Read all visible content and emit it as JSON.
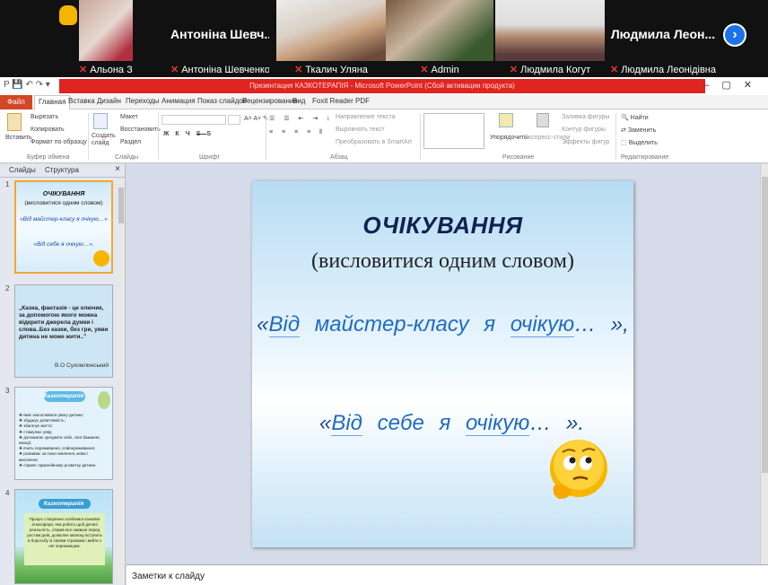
{
  "conference": {
    "participants": [
      {
        "name": "Альона Заїка"
      },
      {
        "name": "Антоніна Шевченко",
        "big": "Антоніна Шевч..."
      },
      {
        "name": "Ткалич Уляна"
      },
      {
        "name": "Admin"
      },
      {
        "name": "Людмила Когут"
      },
      {
        "name": "Людмила Леонідівна",
        "big": "Людмила  Леон..."
      }
    ],
    "next_symbol": "›"
  },
  "window": {
    "title": "Презентация КАЗКОТЕРАПІЯ - Microsoft PowerPoint (Сбой активации продукта)",
    "qat": "P  💾  ↶  ↷  ▾"
  },
  "ribbon_tabs": [
    "Файл",
    "Главная",
    "Вставка",
    "Дизайн",
    "Переходы",
    "Анимация",
    "Показ слайдов",
    "Рецензирование",
    "Вид",
    "Foxit Reader PDF"
  ],
  "ribbon": {
    "clipboard": {
      "paste": "Вставить",
      "cut": "Вырезать",
      "copy": "Копировать",
      "format": "Формат по образцу",
      "label": "Буфер обмена"
    },
    "slides": {
      "new": "Создать слайд",
      "layout": "Макет",
      "reset": "Восстановить",
      "section": "Раздел",
      "label": "Слайды"
    },
    "font": {
      "label": "Шрифт"
    },
    "paragraph": {
      "direction": "Направление текста",
      "align": "Выровнять текст",
      "smartart": "Преобразовать в SmartArt",
      "label": "Абзац"
    },
    "drawing": {
      "arrange": "Упорядочить",
      "styles": "Экспресс-стили",
      "fill": "Заливка фигуры",
      "outline": "Контур фигуры",
      "effects": "Эффекты фигур",
      "label": "Рисование"
    },
    "editing": {
      "find": "Найти",
      "replace": "Заменить",
      "select": "Выделить",
      "label": "Редактирование"
    }
  },
  "left_pane": {
    "tabs": [
      "Слайды",
      "Структура"
    ],
    "close": "×",
    "thumbs": [
      {
        "num": "1",
        "title": "ОЧІКУВАННЯ",
        "sub": "(висловитися одним словом)",
        "l1": "«Від майстер-класу я очікую…»",
        "l2": "«Від себе я очікую…»."
      },
      {
        "num": "2",
        "text": "„Казка, фантазія - це ключик, за допомогою якого можна відкрити джерела думки і слова..Без казки, без гри, уяви дитина не може жити..”",
        "author": "В.О Сухомлинський"
      },
      {
        "num": "3",
        "title": "Казкотерапія",
        "items": [
          "❖ вміє запоплювати увагу дитини;",
          "❖ збуджує допитливість;",
          "❖ збагачує життя;",
          "❖ стимулює уяву;",
          "❖ допомагає зрозуміти себе, свої бажання, емоції;",
          "❖ вчить переживання, співпереживання;",
          "❖ розвиває за поки новлення, мови і мислення;",
          "❖ сприяє гармонійному розвитку дитини."
        ]
      },
      {
        "num": "4",
        "title": "Казкотерапія",
        "text": "Процес створення особливої казкової атмосфери, яка робить щоб дитині реальність, открив все навише перед ростим днів, дозволяє малюку вступити в боротьбу зі своїми страхами і вийти з неї переможцем."
      }
    ]
  },
  "slide": {
    "title": "ОЧІКУВАННЯ",
    "subtitle": "(висловитися одним словом)",
    "line1": {
      "q1": "«",
      "w1": "Від",
      "mid": "майстер-класу  я",
      "w2": "очікую",
      "end": "… »,"
    },
    "line2": {
      "q1": "«",
      "w1": "Від",
      "mid": "себе  я",
      "w2": "очікую",
      "end": "… »."
    }
  },
  "notes": {
    "placeholder": "Заметки к слайду"
  }
}
